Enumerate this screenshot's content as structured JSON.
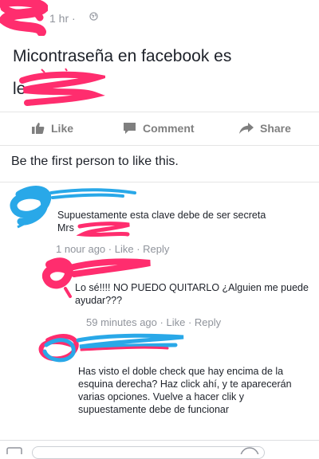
{
  "post": {
    "time": "1 hr ·",
    "text": "Micontraseña en facebook es",
    "password_prefix": "le"
  },
  "actions": {
    "like": "Like",
    "comment": "Comment",
    "share": "Share"
  },
  "likes_summary": "Be the first person to like this.",
  "comments": [
    {
      "text": "Supuestamente esta clave debe de ser secreta",
      "text2": "Mrs",
      "time": "1 nour ago",
      "like": "Like",
      "reply": "Reply"
    },
    {
      "text": "Lo sé!!!! NO PUEDO QUITARLO ¿Alguien me puede ayudar???",
      "time": "59 minutes ago",
      "like": "Like",
      "reply": "Reply"
    },
    {
      "text": "Has visto el doble check que hay encima de la esquina derecha? Haz click ahí, y te aparecerán varias opciones. Vuelve a hacer clik y supuestamente debe de funcionar"
    }
  ],
  "colors": {
    "scribble_pink": "#ff2d6e",
    "scribble_blue": "#29a8e8",
    "fb_gray": "#7f7f7f",
    "meta_gray": "#90949c"
  }
}
